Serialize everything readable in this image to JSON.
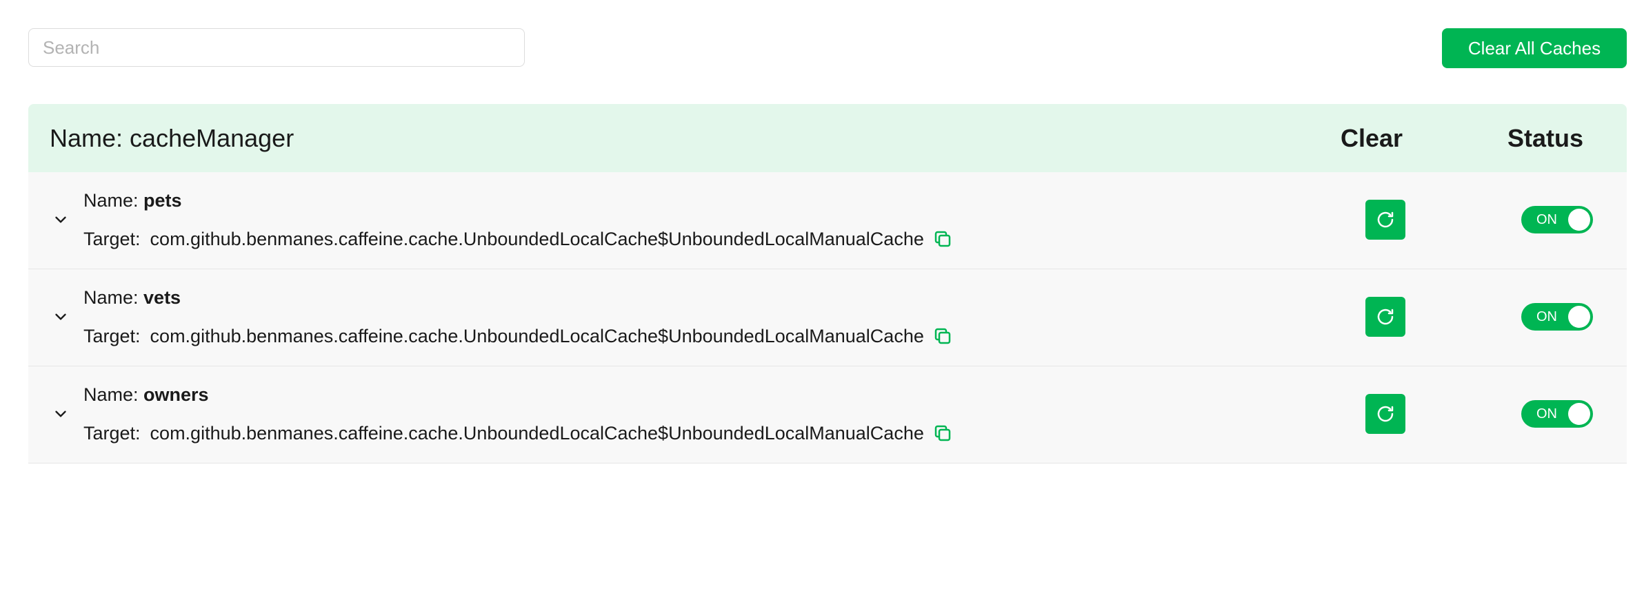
{
  "search": {
    "placeholder": "Search",
    "value": ""
  },
  "toolbar": {
    "clear_all_label": "Clear All Caches"
  },
  "table": {
    "header": {
      "name_prefix": "Name: ",
      "name": "cacheManager",
      "clear_label": "Clear",
      "status_label": "Status"
    },
    "rows": [
      {
        "name_prefix": "Name: ",
        "name": "pets",
        "target_label": "Target:",
        "target": "com.github.benmanes.caffeine.cache.UnboundedLocalCache$UnboundedLocalManualCache",
        "status": "ON"
      },
      {
        "name_prefix": "Name: ",
        "name": "vets",
        "target_label": "Target:",
        "target": "com.github.benmanes.caffeine.cache.UnboundedLocalCache$UnboundedLocalManualCache",
        "status": "ON"
      },
      {
        "name_prefix": "Name: ",
        "name": "owners",
        "target_label": "Target:",
        "target": "com.github.benmanes.caffeine.cache.UnboundedLocalCache$UnboundedLocalManualCache",
        "status": "ON"
      }
    ]
  },
  "icons": {
    "expand": "chevron-down-icon",
    "copy": "copy-icon",
    "refresh": "refresh-icon"
  },
  "colors": {
    "accent": "#00b553",
    "header_bg": "#e3f7eb",
    "row_bg": "#f8f8f8"
  }
}
